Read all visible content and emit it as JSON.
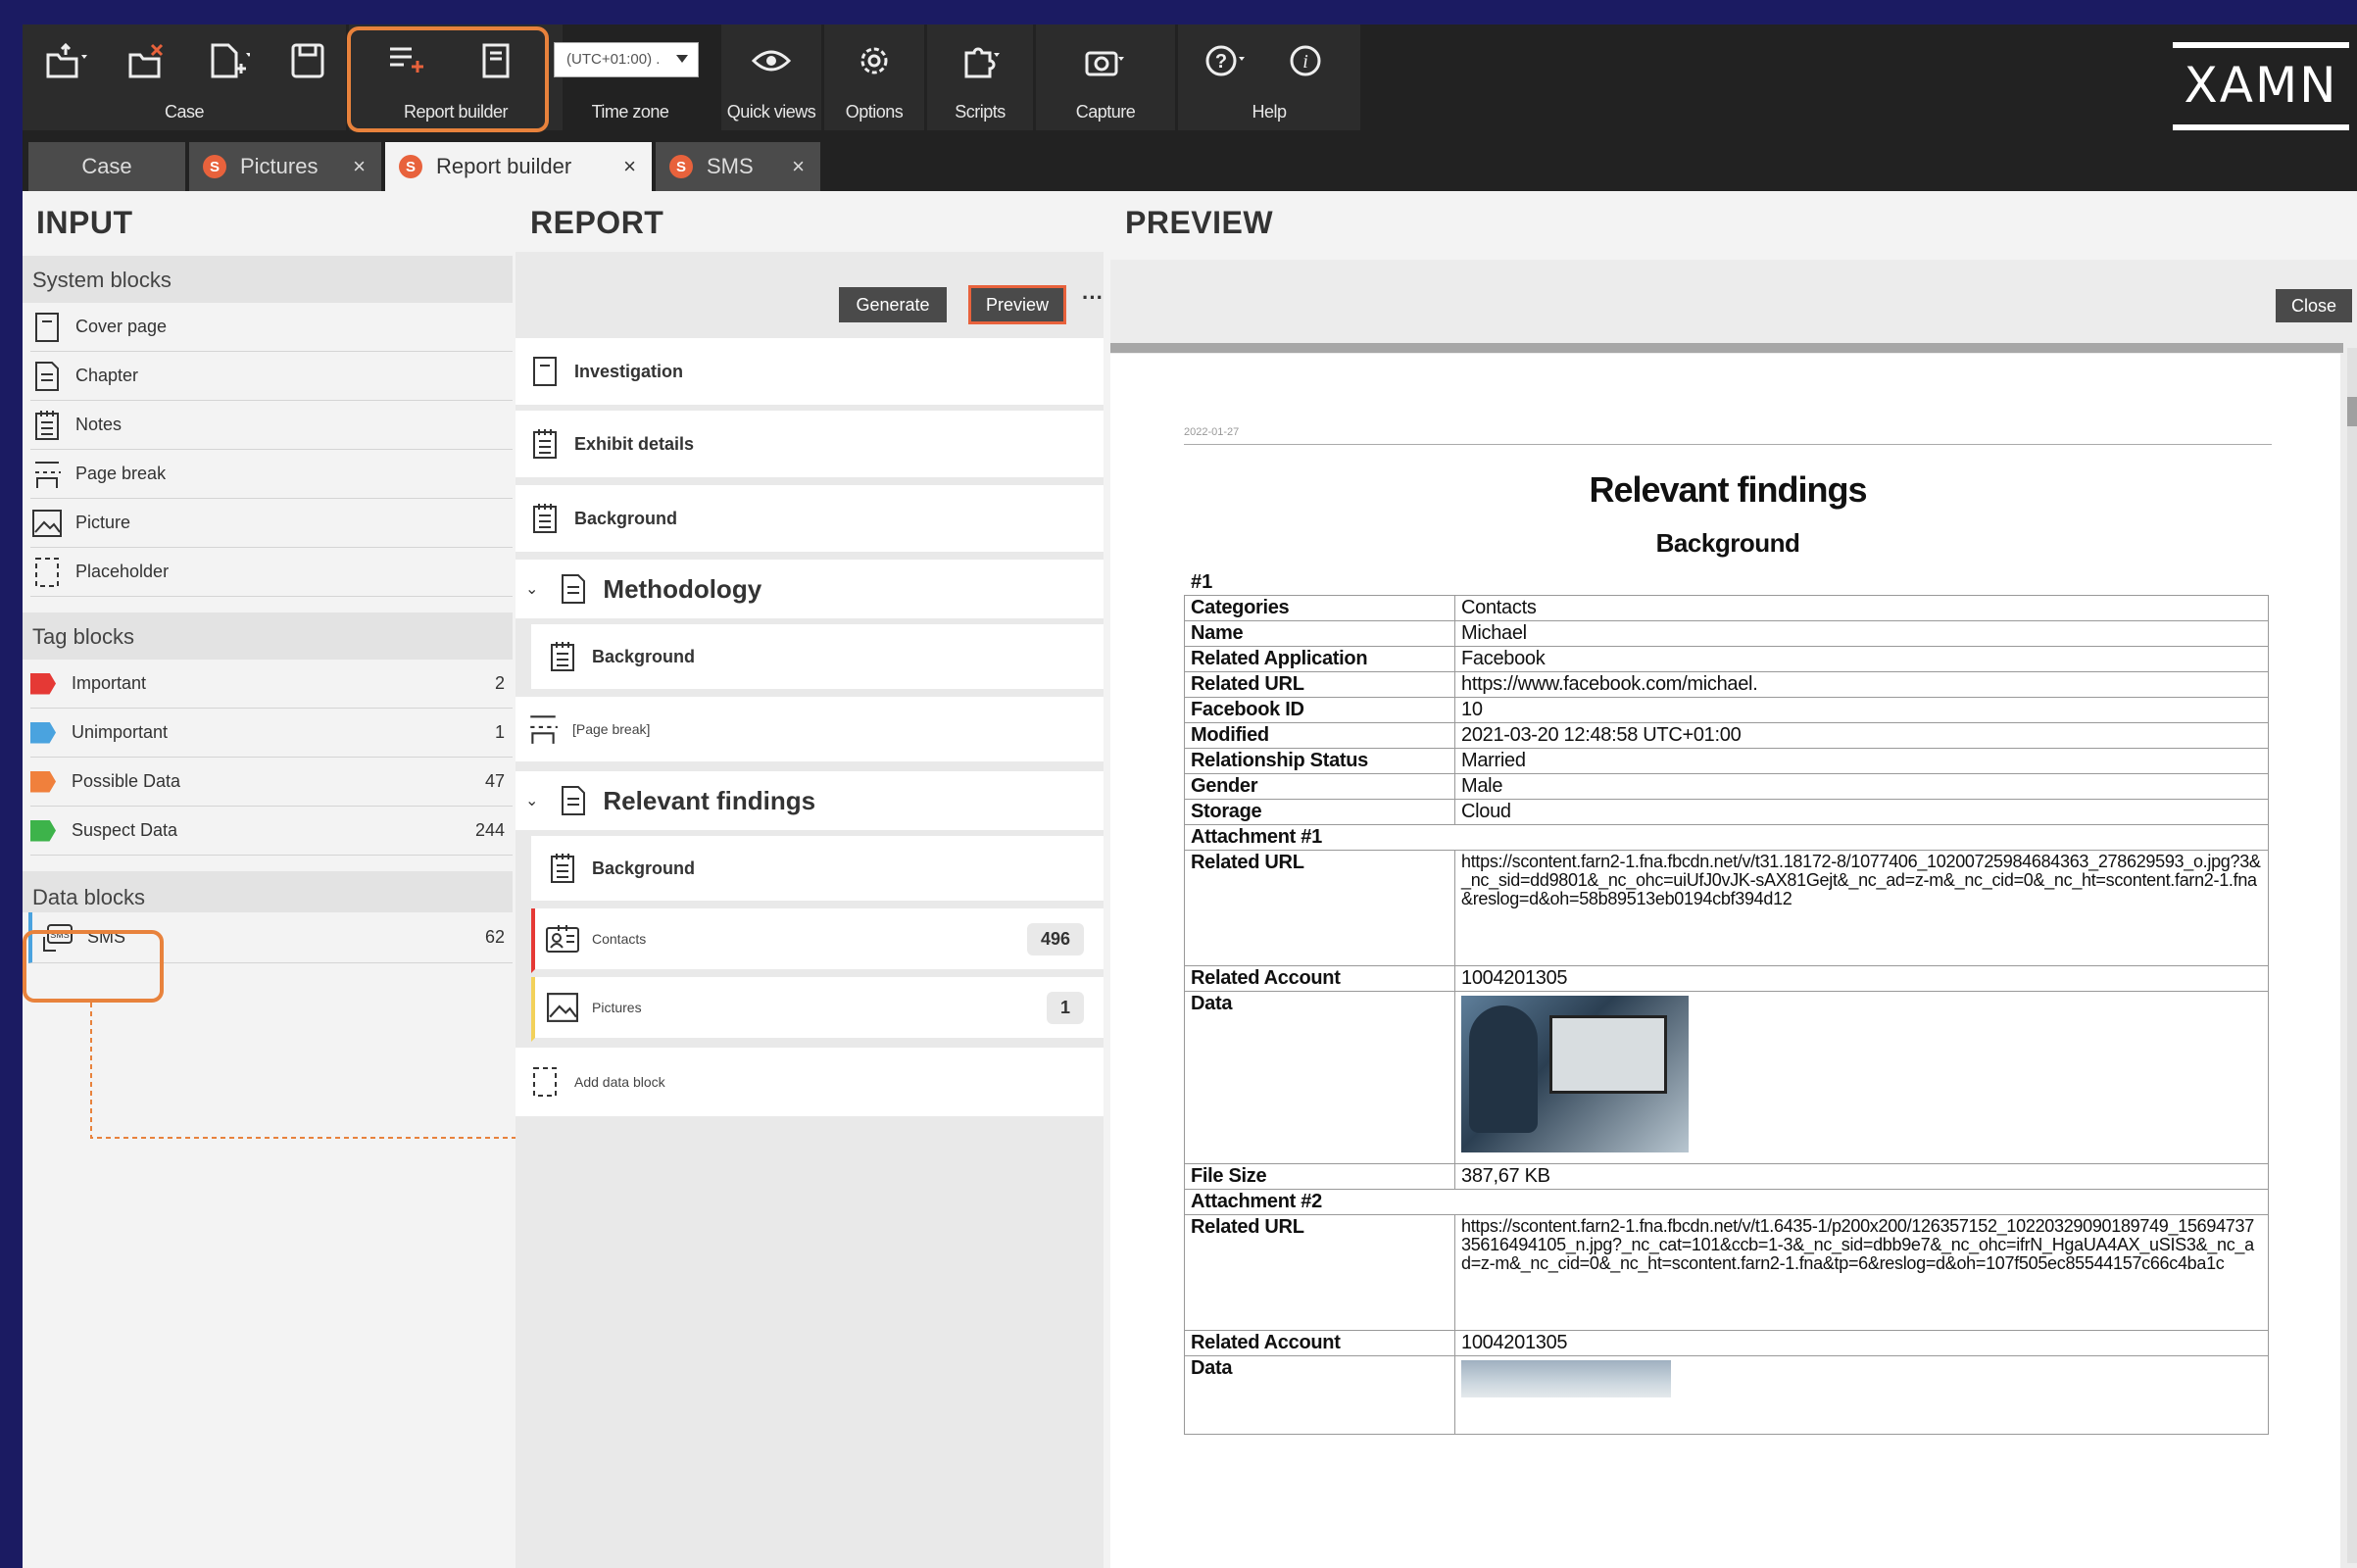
{
  "toolbar": {
    "groups": [
      {
        "label": "Case"
      },
      {
        "label": "Report builder"
      },
      {
        "label": "Time zone"
      },
      {
        "label": "Quick views"
      },
      {
        "label": "Options"
      },
      {
        "label": "Scripts"
      },
      {
        "label": "Capture"
      },
      {
        "label": "Help"
      }
    ],
    "timezone_value": "(UTC+01:00) .",
    "logo": "XAMN"
  },
  "tabs": [
    {
      "label": "Case",
      "badge": ""
    },
    {
      "label": "Pictures",
      "badge": "S"
    },
    {
      "label": "Report builder",
      "badge": "S"
    },
    {
      "label": "SMS",
      "badge": "S"
    }
  ],
  "input": {
    "title": "INPUT",
    "system_blocks": {
      "header": "System blocks",
      "items": [
        "Cover page",
        "Chapter",
        "Notes",
        "Page break",
        "Picture",
        "Placeholder"
      ]
    },
    "tag_blocks": {
      "header": "Tag blocks",
      "items": [
        {
          "label": "Important",
          "count": "2",
          "color": "#e53935"
        },
        {
          "label": "Unimportant",
          "count": "1",
          "color": "#4aa3df"
        },
        {
          "label": "Possible Data",
          "count": "47",
          "color": "#f0803c"
        },
        {
          "label": "Suspect Data",
          "count": "244",
          "color": "#3db34a"
        }
      ]
    },
    "data_blocks": {
      "header": "Data blocks",
      "items": [
        {
          "label": "SMS",
          "count": "62"
        }
      ]
    }
  },
  "report": {
    "title": "REPORT",
    "generate": "Generate",
    "preview": "Preview",
    "more": "···",
    "blocks": {
      "investigation": "Investigation",
      "exhibit": "Exhibit details",
      "background1": "Background",
      "methodology": "Methodology",
      "background2": "Background",
      "pagebreak": "[Page break]",
      "relevant": "Relevant findings",
      "background3": "Background",
      "contacts": "Contacts",
      "contacts_count": "496",
      "pictures": "Pictures",
      "pictures_count": "1",
      "add_data": "Add data block"
    }
  },
  "preview": {
    "title": "PREVIEW",
    "close": "Close",
    "date": "2022-01-27",
    "heading": "Relevant findings",
    "subheading": "Background",
    "record_no": "#1",
    "rows1": [
      {
        "k": "Categories",
        "v": "Contacts"
      },
      {
        "k": "Name",
        "v": "Michael"
      },
      {
        "k": "Related Application",
        "v": "Facebook"
      },
      {
        "k": "Related URL",
        "v": "https://www.facebook.com/michael."
      },
      {
        "k": "Facebook ID",
        "v": "10"
      },
      {
        "k": "Modified",
        "v": "2021-03-20 12:48:58 UTC+01:00"
      },
      {
        "k": "Relationship Status",
        "v": "Married"
      },
      {
        "k": "Gender",
        "v": "Male"
      },
      {
        "k": "Storage",
        "v": "Cloud"
      }
    ],
    "attachment1": "Attachment #1",
    "att1_url_k": "Related URL",
    "att1_url_v": "https://scontent.farn2-1.fna.fbcdn.net/v/t31.18172-8/1077406_10200725984684363_278629593_o.jpg?3&_nc_sid=dd9801&_nc_ohc=uiUfJ0vJK-sAX81Gejt&_nc_ad=z-m&_nc_cid=0&_nc_ht=scontent.farn2-1.fna&reslog=d&oh=58b89513eb0194cbf394d12",
    "att1_acc_k": "Related Account",
    "att1_acc_v": "1004201305",
    "att1_data_k": "Data",
    "att1_size_k": "File Size",
    "att1_size_v": "387,67 KB",
    "attachment2": "Attachment #2",
    "att2_url_k": "Related URL",
    "att2_url_v": "https://scontent.farn2-1.fna.fbcdn.net/v/t1.6435-1/p200x200/126357152_10220329090189749_1569473735616494105_n.jpg?_nc_cat=101&ccb=1-3&_nc_sid=dbb9e7&_nc_ohc=ifrN_HgaUA4AX_uSIS3&_nc_ad=z-m&_nc_cid=0&_nc_ht=scontent.farn2-1.fna&tp=6&reslog=d&oh=107f505ec85544157c66c4ba1c",
    "att2_acc_k": "Related Account",
    "att2_acc_v": "1004201305",
    "att2_data_k": "Data"
  }
}
